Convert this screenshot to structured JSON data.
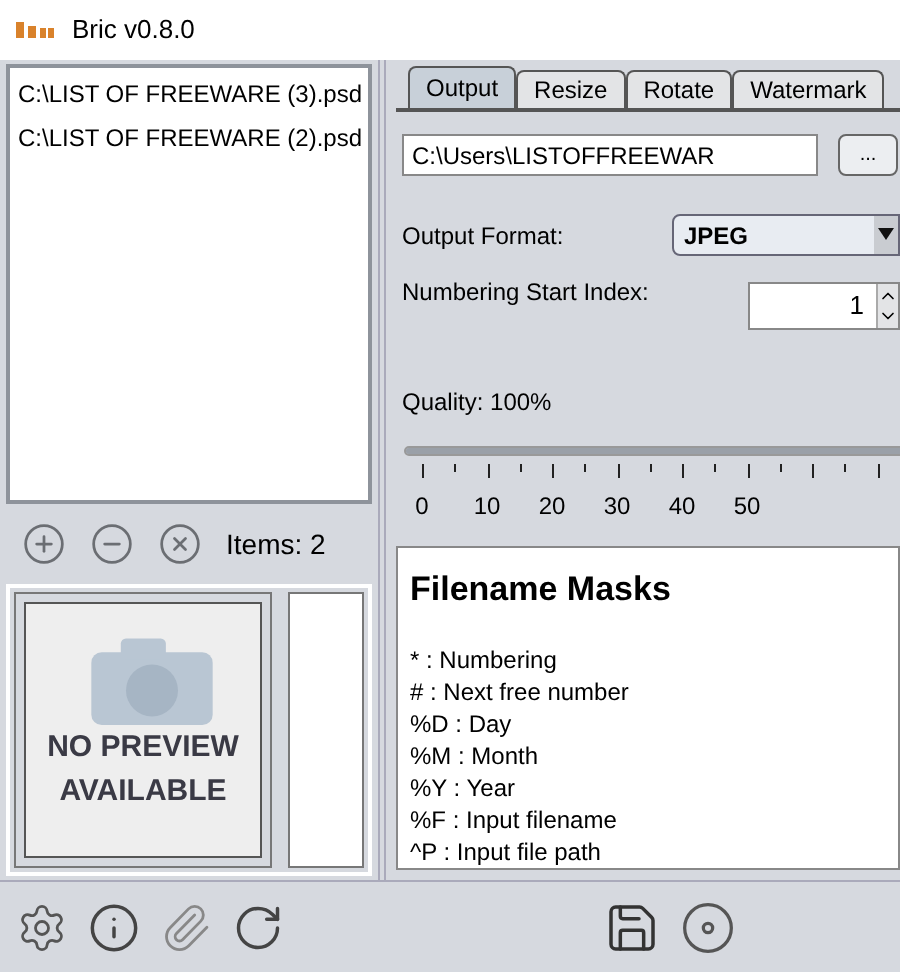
{
  "window": {
    "title": "Bric v0.8.0"
  },
  "files": [
    "C:\\LIST OF FREEWARE (3).psd",
    "C:\\LIST OF FREEWARE (2).psd"
  ],
  "items_count": "Items: 2",
  "preview": {
    "text": "NO PREVIEW AVAILABLE"
  },
  "tabs": [
    {
      "label": "Output",
      "selected": true
    },
    {
      "label": "Resize",
      "selected": false
    },
    {
      "label": "Rotate",
      "selected": false
    },
    {
      "label": "Watermark",
      "selected": false
    }
  ],
  "output_path": {
    "value": "C:\\Users\\LISTOFFREEWAR",
    "browse": "..."
  },
  "output_format": {
    "label": "Output Format:",
    "value": "JPEG"
  },
  "numbering": {
    "label": "Numbering Start Index:",
    "value": "1"
  },
  "quality": {
    "label": "Quality: 100%",
    "level": 1,
    "tick_labels": [
      "0",
      "10",
      "20",
      "30",
      "40",
      "50"
    ]
  },
  "masks": {
    "title": "Filename Masks",
    "lines": [
      "* : Numbering",
      "# : Next free number",
      "%D : Day",
      "%M : Month",
      "%Y : Year",
      "%F : Input filename",
      "^P : Input file path"
    ]
  }
}
